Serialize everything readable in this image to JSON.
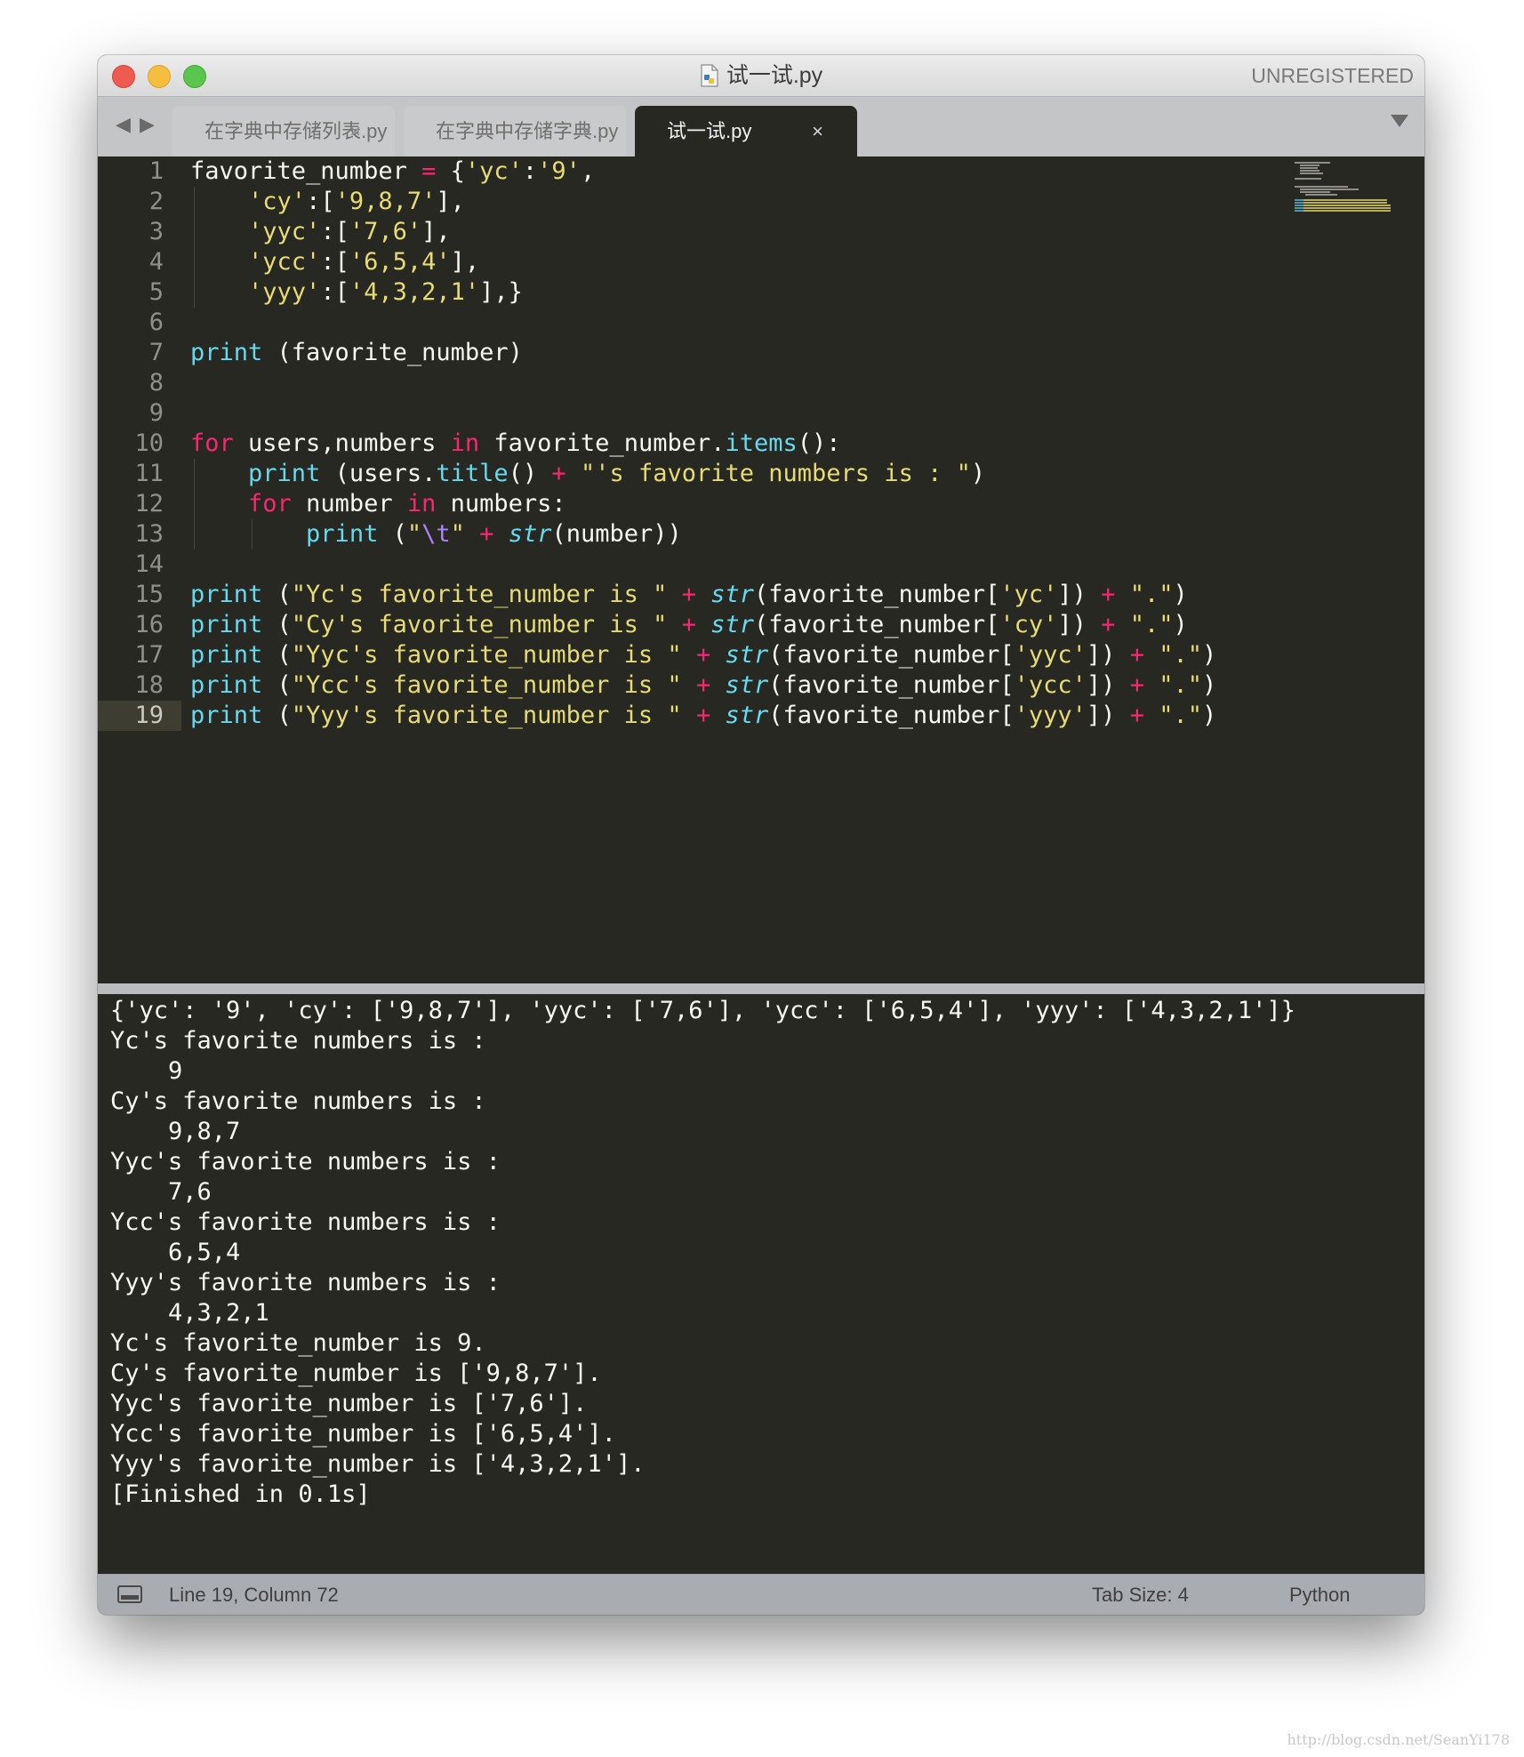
{
  "window": {
    "title": "试一试.py",
    "unregistered": "UNREGISTERED"
  },
  "tabs": [
    {
      "label": "在字典中存储列表.py",
      "close": "×",
      "active": false
    },
    {
      "label": "在字典中存储字典.py",
      "close": "×",
      "active": false
    },
    {
      "label": "试一试.py",
      "close": "×",
      "active": true
    }
  ],
  "nav_arrows": "◀ ▶",
  "editor": {
    "line_numbers": [
      "1",
      "2",
      "3",
      "4",
      "5",
      "6",
      "7",
      "8",
      "9",
      "10",
      "11",
      "12",
      "13",
      "14",
      "15",
      "16",
      "17",
      "18",
      "19"
    ],
    "current_line": 19,
    "lines": [
      [
        [
          "",
          "favorite_number "
        ],
        [
          "op",
          "="
        ],
        [
          "",
          " {"
        ],
        [
          "st",
          "'yc'"
        ],
        [
          "",
          ":"
        ],
        [
          "st",
          "'9'"
        ],
        [
          "",
          ","
        ]
      ],
      [
        [
          "",
          "    "
        ],
        [
          "st",
          "'cy'"
        ],
        [
          "",
          ":["
        ],
        [
          "st",
          "'9,8,7'"
        ],
        [
          "",
          "],"
        ]
      ],
      [
        [
          "",
          "    "
        ],
        [
          "st",
          "'yyc'"
        ],
        [
          "",
          ":["
        ],
        [
          "st",
          "'7,6'"
        ],
        [
          "",
          "],"
        ]
      ],
      [
        [
          "",
          "    "
        ],
        [
          "st",
          "'ycc'"
        ],
        [
          "",
          ":["
        ],
        [
          "st",
          "'6,5,4'"
        ],
        [
          "",
          "],"
        ]
      ],
      [
        [
          "",
          "    "
        ],
        [
          "st",
          "'yyy'"
        ],
        [
          "",
          ":["
        ],
        [
          "st",
          "'4,3,2,1'"
        ],
        [
          "",
          "],}"
        ]
      ],
      [],
      [
        [
          "fn",
          "print"
        ],
        [
          "",
          " (favorite_number)"
        ]
      ],
      [],
      [],
      [
        [
          "kw",
          "for"
        ],
        [
          "",
          " users,numbers "
        ],
        [
          "kw",
          "in"
        ],
        [
          "",
          " favorite_number."
        ],
        [
          "fn",
          "items"
        ],
        [
          "",
          "():"
        ]
      ],
      [
        [
          "",
          "    "
        ],
        [
          "fn",
          "print"
        ],
        [
          "",
          " (users."
        ],
        [
          "fn",
          "title"
        ],
        [
          "",
          "() "
        ],
        [
          "op",
          "+"
        ],
        [
          "",
          " "
        ],
        [
          "st",
          "\"'s favorite numbers is : \""
        ],
        [
          "",
          ")"
        ]
      ],
      [
        [
          "",
          "    "
        ],
        [
          "kw",
          "for"
        ],
        [
          "",
          " number "
        ],
        [
          "kw",
          "in"
        ],
        [
          "",
          " numbers:"
        ]
      ],
      [
        [
          "",
          "        "
        ],
        [
          "fn",
          "print"
        ],
        [
          "",
          " ("
        ],
        [
          "st",
          "\""
        ],
        [
          "es",
          "\\t"
        ],
        [
          "st",
          "\""
        ],
        [
          "",
          " "
        ],
        [
          "op",
          "+"
        ],
        [
          "",
          " "
        ],
        [
          "it",
          "str"
        ],
        [
          "",
          "(number))"
        ]
      ],
      [],
      [
        [
          "fn",
          "print"
        ],
        [
          "",
          " ("
        ],
        [
          "st",
          "\"Yc's favorite_number is \""
        ],
        [
          "",
          " "
        ],
        [
          "op",
          "+"
        ],
        [
          "",
          " "
        ],
        [
          "it",
          "str"
        ],
        [
          "",
          "(favorite_number["
        ],
        [
          "st",
          "'yc'"
        ],
        [
          "",
          "]) "
        ],
        [
          "op",
          "+"
        ],
        [
          "",
          " "
        ],
        [
          "st",
          "\".\""
        ],
        [
          "",
          ")"
        ]
      ],
      [
        [
          "fn",
          "print"
        ],
        [
          "",
          " ("
        ],
        [
          "st",
          "\"Cy's favorite_number is \""
        ],
        [
          "",
          " "
        ],
        [
          "op",
          "+"
        ],
        [
          "",
          " "
        ],
        [
          "it",
          "str"
        ],
        [
          "",
          "(favorite_number["
        ],
        [
          "st",
          "'cy'"
        ],
        [
          "",
          "]) "
        ],
        [
          "op",
          "+"
        ],
        [
          "",
          " "
        ],
        [
          "st",
          "\".\""
        ],
        [
          "",
          ")"
        ]
      ],
      [
        [
          "fn",
          "print"
        ],
        [
          "",
          " ("
        ],
        [
          "st",
          "\"Yyc's favorite_number is \""
        ],
        [
          "",
          " "
        ],
        [
          "op",
          "+"
        ],
        [
          "",
          " "
        ],
        [
          "it",
          "str"
        ],
        [
          "",
          "(favorite_number["
        ],
        [
          "st",
          "'yyc'"
        ],
        [
          "",
          "]) "
        ],
        [
          "op",
          "+"
        ],
        [
          "",
          " "
        ],
        [
          "st",
          "\".\""
        ],
        [
          "",
          ")"
        ]
      ],
      [
        [
          "fn",
          "print"
        ],
        [
          "",
          " ("
        ],
        [
          "st",
          "\"Ycc's favorite_number is \""
        ],
        [
          "",
          " "
        ],
        [
          "op",
          "+"
        ],
        [
          "",
          " "
        ],
        [
          "it",
          "str"
        ],
        [
          "",
          "(favorite_number["
        ],
        [
          "st",
          "'ycc'"
        ],
        [
          "",
          "]) "
        ],
        [
          "op",
          "+"
        ],
        [
          "",
          " "
        ],
        [
          "st",
          "\".\""
        ],
        [
          "",
          ")"
        ]
      ],
      [
        [
          "fn",
          "print"
        ],
        [
          "",
          " ("
        ],
        [
          "st",
          "\"Yyy's favorite_number is \""
        ],
        [
          "",
          " "
        ],
        [
          "op",
          "+"
        ],
        [
          "",
          " "
        ],
        [
          "it",
          "str"
        ],
        [
          "",
          "(favorite_number["
        ],
        [
          "st",
          "'yyy'"
        ],
        [
          "",
          "]) "
        ],
        [
          "op",
          "+"
        ],
        [
          "",
          " "
        ],
        [
          "st",
          "\".\""
        ],
        [
          "",
          ")"
        ]
      ]
    ]
  },
  "output": {
    "lines": [
      "{'yc': '9', 'cy': ['9,8,7'], 'yyc': ['7,6'], 'ycc': ['6,5,4'], 'yyy': ['4,3,2,1']}",
      "Yc's favorite numbers is :",
      "    9",
      "Cy's favorite numbers is :",
      "    9,8,7",
      "Yyc's favorite numbers is :",
      "    7,6",
      "Ycc's favorite numbers is :",
      "    6,5,4",
      "Yyy's favorite numbers is :",
      "    4,3,2,1",
      "Yc's favorite_number is 9.",
      "Cy's favorite_number is ['9,8,7'].",
      "Yyc's favorite_number is ['7,6'].",
      "Ycc's favorite_number is ['6,5,4'].",
      "Yyy's favorite_number is ['4,3,2,1'].",
      "[Finished in 0.1s]"
    ]
  },
  "statusbar": {
    "position": "Line 19, Column 72",
    "tab_size": "Tab Size: 4",
    "syntax": "Python"
  },
  "watermark": "http://blog.csdn.net/SeanYi178",
  "colors": {
    "editor_bg": "#272822",
    "keyword": "#f92672",
    "function": "#66d9ef",
    "string": "#e6db74",
    "escape": "#ae81ff",
    "text": "#f8f8f2"
  }
}
